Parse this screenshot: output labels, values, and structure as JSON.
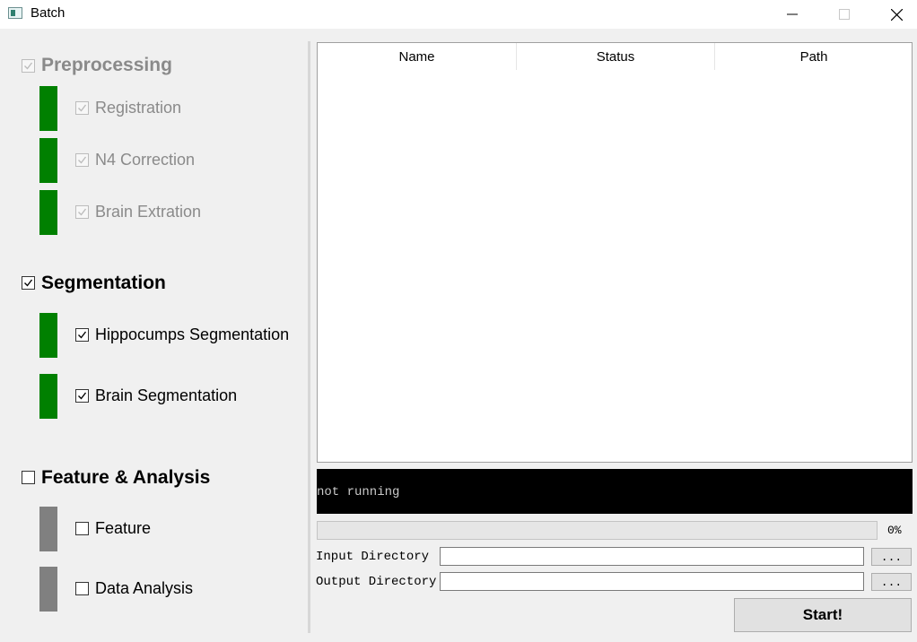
{
  "window": {
    "title": "Batch"
  },
  "colors": {
    "status_done": "#008000",
    "status_idle": "#808080",
    "console_bg": "#000000",
    "disabled_text": "#8a8a8a"
  },
  "groups": {
    "preprocessing": {
      "label": "Preprocessing",
      "checked": true,
      "enabled": false,
      "items": [
        {
          "label": "Registration",
          "checked": true,
          "enabled": false,
          "status": "done"
        },
        {
          "label": "N4 Correction",
          "checked": true,
          "enabled": false,
          "status": "done"
        },
        {
          "label": "Brain Extration",
          "checked": true,
          "enabled": false,
          "status": "done"
        }
      ]
    },
    "segmentation": {
      "label": "Segmentation",
      "checked": true,
      "enabled": true,
      "items": [
        {
          "label": "Hippocumps Segmentation",
          "checked": true,
          "enabled": true,
          "status": "done"
        },
        {
          "label": "Brain Segmentation",
          "checked": true,
          "enabled": true,
          "status": "done"
        }
      ]
    },
    "feature_analysis": {
      "label": "Feature & Analysis",
      "checked": false,
      "enabled": true,
      "items": [
        {
          "label": "Feature",
          "checked": false,
          "enabled": true,
          "status": "idle"
        },
        {
          "label": "Data Analysis",
          "checked": false,
          "enabled": true,
          "status": "idle"
        }
      ]
    }
  },
  "table": {
    "columns": [
      "Name",
      "Status",
      "Path"
    ],
    "rows": []
  },
  "console": {
    "text": "not running"
  },
  "progress": {
    "value": 0,
    "label": "0%"
  },
  "inputs": {
    "input_dir_label": "Input Directory",
    "input_dir_value": "",
    "output_dir_label": "Output Directory",
    "output_dir_value": "",
    "browse_label": "..."
  },
  "start_button": {
    "label": "Start!"
  }
}
